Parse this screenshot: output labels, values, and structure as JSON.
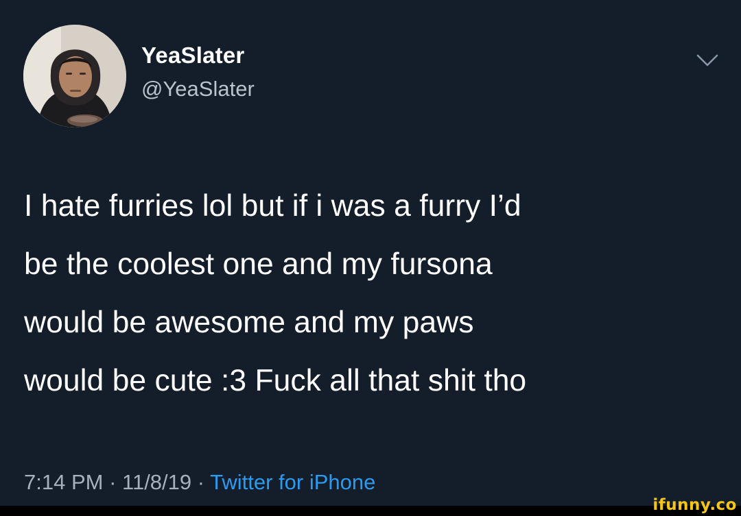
{
  "user": {
    "display_name": "YeaSlater",
    "handle": "@YeaSlater",
    "avatar_icon": "profile-photo"
  },
  "menu": {
    "icon": "chevron-down-icon"
  },
  "tweet": {
    "text": "I hate furries lol but if i was a furry I’d\nbe the coolest one and my fursona\nwould be awesome and my paws\nwould be cute :3 Fuck all that shit tho"
  },
  "meta": {
    "time": "7:14 PM",
    "separator": " · ",
    "date": "11/8/19",
    "source": "Twitter for iPhone"
  },
  "watermark": {
    "text": "ifunny.co"
  },
  "colors": {
    "background": "#141d2a",
    "link": "#2b9bf0",
    "secondary_text": "#a7b1bb",
    "watermark": "#f5c518"
  }
}
